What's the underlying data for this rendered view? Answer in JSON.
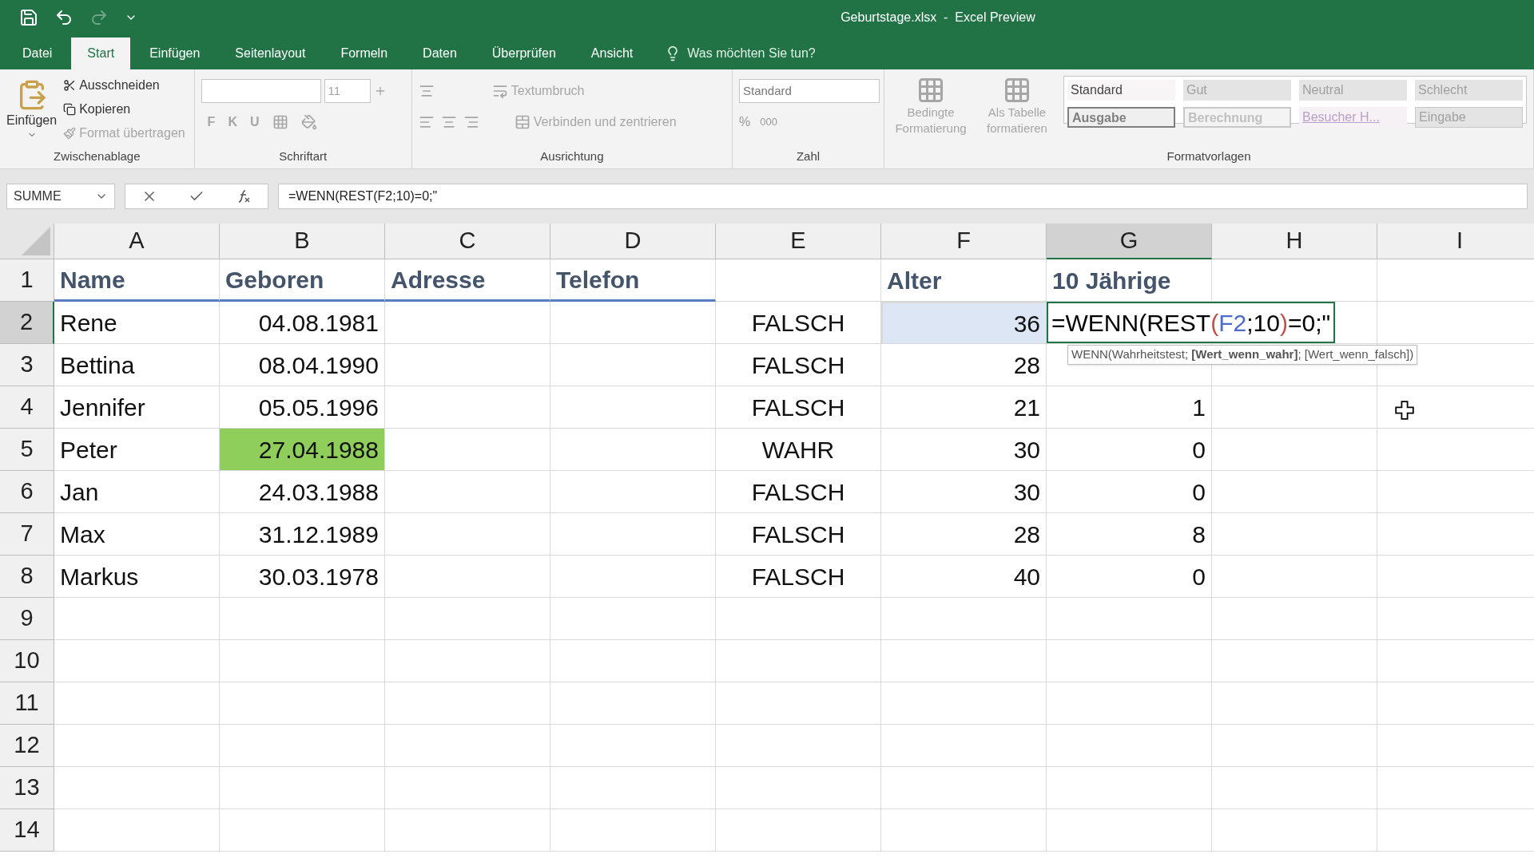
{
  "window": {
    "title": "Geburtstage.xlsx  -  Excel Preview"
  },
  "tabs": [
    {
      "label": "Datei",
      "selected": false
    },
    {
      "label": "Start",
      "selected": true
    },
    {
      "label": "Einfügen",
      "selected": false
    },
    {
      "label": "Seitenlayout",
      "selected": false
    },
    {
      "label": "Formeln",
      "selected": false
    },
    {
      "label": "Daten",
      "selected": false
    },
    {
      "label": "Überprüfen",
      "selected": false
    },
    {
      "label": "Ansicht",
      "selected": false
    }
  ],
  "tell_me": {
    "placeholder": "Was möchten Sie tun?"
  },
  "ribbon": {
    "clipboard": {
      "label": "Zwischenablage",
      "paste": "Einfügen",
      "commands": [
        {
          "kind": "cut",
          "label": "Ausschneiden",
          "disabled": false
        },
        {
          "kind": "copy",
          "label": "Kopieren",
          "disabled": false
        },
        {
          "kind": "painter",
          "label": "Format übertragen",
          "disabled": true
        }
      ]
    },
    "font": {
      "label": "Schriftart",
      "size": "11",
      "style_buttons": [
        "F",
        "K",
        "U"
      ]
    },
    "alignment": {
      "label": "Ausrichtung",
      "wrap": "Textumbruch",
      "merge": "Verbinden und zentrieren"
    },
    "number": {
      "label": "Zahl",
      "format": "Standard",
      "percent": "%",
      "thousands": "000"
    },
    "styles": {
      "label": "Formatvorlagen",
      "conditional": [
        "Bedingte",
        "Formatierung"
      ],
      "as_table": [
        "Als Tabelle",
        "formatieren"
      ],
      "cells": [
        {
          "label": "Standard",
          "kind": "plain"
        },
        {
          "label": "Gut",
          "kind": "muted"
        },
        {
          "label": "Neutral",
          "kind": "muted"
        },
        {
          "label": "Schlecht",
          "kind": "muted"
        },
        {
          "label": "Ausgabe",
          "kind": "output"
        },
        {
          "label": "Berechnung",
          "kind": "calculation"
        },
        {
          "label": "Besucher H...",
          "kind": "link"
        },
        {
          "label": "Eingabe",
          "kind": "input"
        }
      ]
    }
  },
  "formula_bar": {
    "name_box": "SUMME",
    "formula": "=WENN(REST(F2;10)=0;\""
  },
  "columns": [
    {
      "label": "A",
      "selected": false
    },
    {
      "label": "B",
      "selected": false
    },
    {
      "label": "C",
      "selected": false
    },
    {
      "label": "D",
      "selected": false
    },
    {
      "label": "E",
      "selected": false
    },
    {
      "label": "F",
      "selected": false
    },
    {
      "label": "G",
      "selected": true
    },
    {
      "label": "H",
      "selected": false
    },
    {
      "label": "I",
      "selected": false
    }
  ],
  "rows": [
    {
      "number": "1",
      "selected": false,
      "cells": {
        "A": {
          "kind": "heading",
          "text": "Name"
        },
        "B": {
          "kind": "heading",
          "text": "Geboren"
        },
        "C": {
          "kind": "heading",
          "text": "Adresse"
        },
        "D": {
          "kind": "heading",
          "text": "Telefon"
        },
        "F": {
          "kind": "heading",
          "text": "Alter"
        },
        "G": {
          "kind": "heading",
          "text": "10 Jährige"
        }
      }
    },
    {
      "number": "2",
      "selected": true,
      "cells": {
        "A": {
          "kind": "text",
          "text": "Rene"
        },
        "B": {
          "kind": "number",
          "text": "04.08.1981"
        },
        "E": {
          "kind": "center",
          "text": "FALSCH"
        },
        "F": {
          "kind": "number",
          "text": "36",
          "selected": true
        },
        "G": {
          "kind": "editing",
          "segments": [
            {
              "text": "=WENN(REST",
              "color": "#000000"
            },
            {
              "text": "(",
              "color": "#c0504d"
            },
            {
              "text": "F2",
              "color": "#4f6bc9"
            },
            {
              "text": ";10",
              "color": "#000000"
            },
            {
              "text": ")",
              "color": "#c0504d"
            },
            {
              "text": "=0;\"",
              "color": "#000000"
            }
          ],
          "hint": "WENN(Wahrheitstest; **[Wert_wenn_wahr]**; [Wert_wenn_falsch])"
        }
      }
    },
    {
      "number": "3",
      "selected": false,
      "cells": {
        "A": {
          "kind": "text",
          "text": "Bettina"
        },
        "B": {
          "kind": "number",
          "text": "08.04.1990"
        },
        "E": {
          "kind": "center",
          "text": "FALSCH"
        },
        "F": {
          "kind": "number",
          "text": "28"
        }
      }
    },
    {
      "number": "4",
      "selected": false,
      "cells": {
        "A": {
          "kind": "text",
          "text": "Jennifer"
        },
        "B": {
          "kind": "number",
          "text": "05.05.1996"
        },
        "E": {
          "kind": "center",
          "text": "FALSCH"
        },
        "F": {
          "kind": "number",
          "text": "21"
        },
        "G": {
          "kind": "number",
          "text": "1"
        }
      }
    },
    {
      "number": "5",
      "selected": false,
      "cells": {
        "A": {
          "kind": "text",
          "text": "Peter"
        },
        "B": {
          "kind": "number",
          "text": "27.04.1988",
          "color": "#8fce5a"
        },
        "E": {
          "kind": "center",
          "text": "WAHR"
        },
        "F": {
          "kind": "number",
          "text": "30"
        },
        "G": {
          "kind": "number",
          "text": "0"
        }
      }
    },
    {
      "number": "6",
      "selected": false,
      "cells": {
        "A": {
          "kind": "text",
          "text": "Jan"
        },
        "B": {
          "kind": "number",
          "text": "24.03.1988"
        },
        "E": {
          "kind": "center",
          "text": "FALSCH"
        },
        "F": {
          "kind": "number",
          "text": "30"
        },
        "G": {
          "kind": "number",
          "text": "0"
        }
      }
    },
    {
      "number": "7",
      "selected": false,
      "cells": {
        "A": {
          "kind": "text",
          "text": "Max"
        },
        "B": {
          "kind": "number",
          "text": "31.12.1989"
        },
        "E": {
          "kind": "center",
          "text": "FALSCH"
        },
        "F": {
          "kind": "number",
          "text": "28"
        },
        "G": {
          "kind": "number",
          "text": "8"
        }
      }
    },
    {
      "number": "8",
      "selected": false,
      "cells": {
        "A": {
          "kind": "text",
          "text": "Markus"
        },
        "B": {
          "kind": "number",
          "text": "30.03.1978"
        },
        "E": {
          "kind": "center",
          "text": "FALSCH"
        },
        "F": {
          "kind": "number",
          "text": "40"
        },
        "G": {
          "kind": "number",
          "text": "0"
        }
      }
    },
    {
      "number": "9",
      "selected": false,
      "cells": {}
    },
    {
      "number": "10",
      "selected": false,
      "cells": {}
    },
    {
      "number": "11",
      "selected": false,
      "cells": {}
    },
    {
      "number": "12",
      "selected": false,
      "cells": {}
    },
    {
      "number": "13",
      "selected": false,
      "cells": {}
    },
    {
      "number": "14",
      "selected": false,
      "cells": {}
    }
  ]
}
